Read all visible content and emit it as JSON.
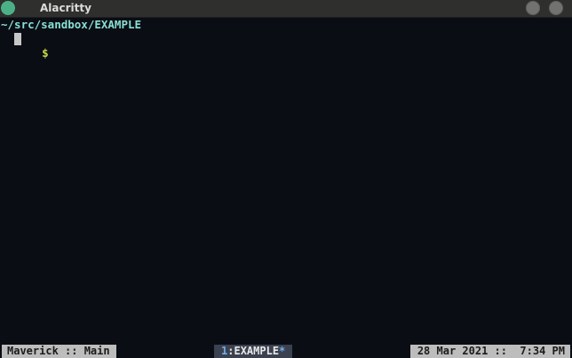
{
  "window": {
    "title": "Alacritty"
  },
  "terminal": {
    "cwd": "~/src/sandbox/EXAMPLE",
    "prompt_symbol": "$"
  },
  "statusbar": {
    "session": "Maverick :: Main",
    "window_index": "1",
    "window_separator": ":",
    "window_name": "EXAMPLE",
    "window_flag": "*",
    "datetime": "28 Mar 2021 ::  7:34 PM"
  },
  "colors": {
    "background": "#0a0d14",
    "path": "#88dfd3",
    "prompt": "#c8d84a",
    "status_light": "#bdbdbd",
    "status_active": "#3c4150",
    "titlebar": "#2f2f2d"
  }
}
